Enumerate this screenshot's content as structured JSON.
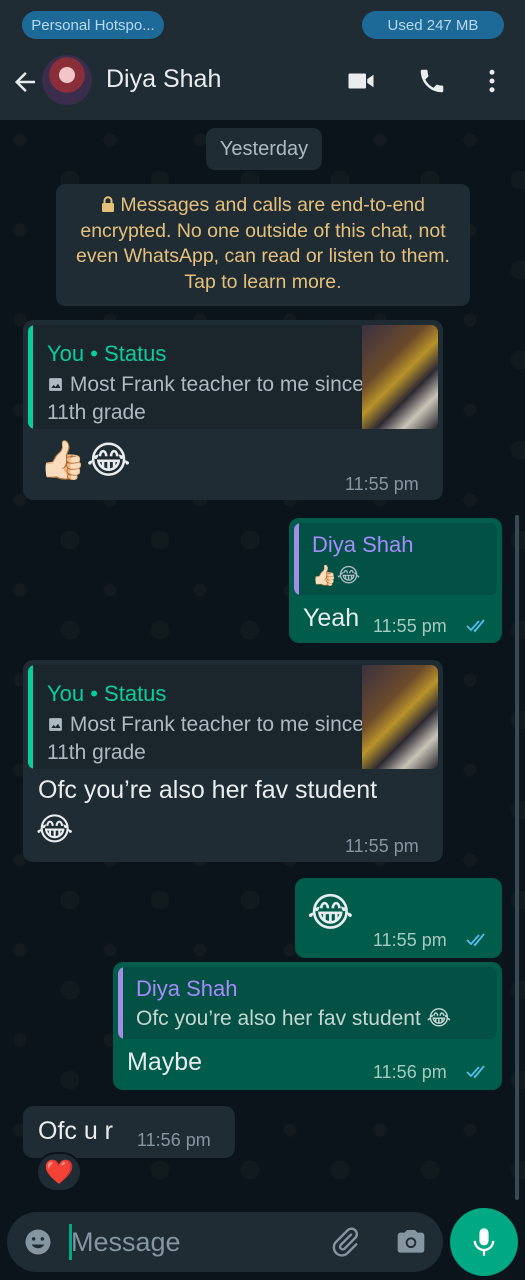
{
  "status_bar": {
    "hotspot": "Personal Hotspo...",
    "usage": "Used  247 MB"
  },
  "header": {
    "name": "Diya Shah"
  },
  "chat": {
    "date": "Yesterday",
    "encryption_notice": "Messages and calls are end-to-end encrypted. No one outside of this chat, not even WhatsApp, can read or listen to them. Tap to learn more.",
    "messages": [
      {
        "direction": "incoming",
        "quote_author": "You • Status",
        "quote_text": "Most Frank teacher to me since 11th grade",
        "text": "👍🏻😂",
        "time": "11:55 pm"
      },
      {
        "direction": "outgoing",
        "quote_author": "Diya Shah",
        "quote_text": "👍🏻😂",
        "text": "Yeah",
        "time": "11:55 pm"
      },
      {
        "direction": "incoming",
        "quote_author": "You • Status",
        "quote_text": "Most Frank teacher to me since 11th grade",
        "text": "Ofc you’re also her fav student",
        "text_emoji": "😂",
        "time": "11:55 pm"
      },
      {
        "direction": "outgoing",
        "text": "😂",
        "time": "11:55 pm"
      },
      {
        "direction": "outgoing",
        "quote_author": "Diya Shah",
        "quote_text": "Ofc you’re also her fav student 😂",
        "text": "Maybe",
        "time": "11:56 pm"
      },
      {
        "direction": "incoming",
        "text": "Ofc u r",
        "time": "11:56 pm",
        "reaction": "❤️"
      }
    ]
  },
  "composer": {
    "placeholder": "Message"
  },
  "colors": {
    "outgoing_bubble": "#005c4b",
    "incoming_bubble": "#1f2c34",
    "accent": "#00a884",
    "encryption_text": "#e5c07b"
  },
  "icons": [
    "back-arrow-icon",
    "video-call-icon",
    "phone-icon",
    "more-vert-icon",
    "lock-icon",
    "image-icon",
    "double-check-icon",
    "emoji-icon",
    "attach-icon",
    "camera-icon",
    "mic-icon"
  ]
}
